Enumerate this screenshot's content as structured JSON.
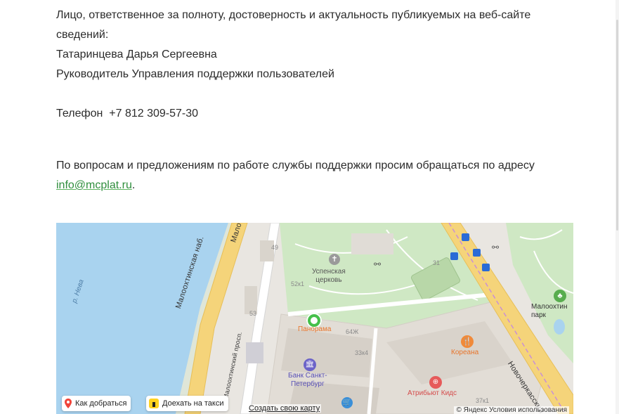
{
  "text": {
    "responsible_line1": "Лицо, ответственное за полноту, достоверность и актуальность публикуемых на веб-сайте",
    "responsible_line2": "сведений:",
    "person_name": "Татаринцева Дарья Сергеевна",
    "person_position": "Руководитель Управления поддержки пользователей",
    "phone_label": "Телефон",
    "phone_value": "+7 812 309-57-30",
    "questions_text": "По вопросам и предложениям по работе службы поддержки просим обращаться по адресу",
    "email": "info@mcplat.ru",
    "email_suffix": "."
  },
  "map": {
    "streets": {
      "embankment": "Малоохтинская наб.",
      "embankment_top": "Мало",
      "prospect": "Малоохтинский просп.",
      "novocherkassky": "Новочеркасский п",
      "river": "р. Нева"
    },
    "pois": {
      "church": "Успенская\nцерковь",
      "panorama": "Панорама",
      "koreana": "Кореана",
      "bank": "Банк Санкт-\nПетербург",
      "atribut": "Атрибьют Кидс",
      "park": "Малоохтин\nпарк"
    },
    "numbers": [
      "49",
      "52к1",
      "31",
      "53",
      "64Ж",
      "33к4",
      "37к1"
    ],
    "controls": {
      "route_button": "Как добраться",
      "taxi_button": "Доехать на такси",
      "create_map": "Создать свою карту",
      "copyright": "© Яндекс Условия использования"
    }
  },
  "colors": {
    "link": "#2f8e3d",
    "water": "#a9d3ef",
    "park": "#cfe8c4",
    "road_major": "#f5d47a",
    "food_icon": "#f08a3a",
    "kids_icon": "#e65a5a",
    "bank_icon": "#6c63c8",
    "marker": "#45c04a"
  }
}
